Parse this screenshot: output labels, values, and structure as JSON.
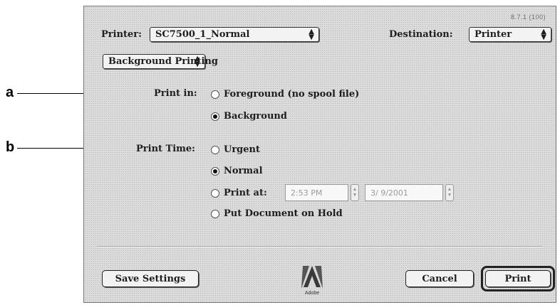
{
  "callouts": {
    "a": "a",
    "b": "b"
  },
  "dialog": {
    "version": "8.7.1 (100)",
    "printer_label": "Printer:",
    "printer_value": "SC7500_1_Normal",
    "destination_label": "Destination:",
    "destination_value": "Printer",
    "panel_value": "Background Printing",
    "print_in": {
      "label": "Print in:",
      "options": [
        {
          "label": "Foreground (no spool file)",
          "selected": false
        },
        {
          "label": "Background",
          "selected": true
        }
      ]
    },
    "print_time": {
      "label": "Print Time:",
      "options": [
        {
          "label": "Urgent",
          "selected": false
        },
        {
          "label": "Normal",
          "selected": true
        },
        {
          "label": "Print at:",
          "selected": false
        },
        {
          "label": "Put Document on Hold",
          "selected": false
        }
      ],
      "time_value": "2:53 PM",
      "date_value": "3/ 9/2001"
    },
    "logo_text": "Adobe",
    "buttons": {
      "save_settings": "Save Settings",
      "cancel": "Cancel",
      "print": "Print"
    }
  },
  "icons": {
    "popup_arrows": "updown-arrows-icon",
    "logo": "adobe-logo-icon"
  }
}
